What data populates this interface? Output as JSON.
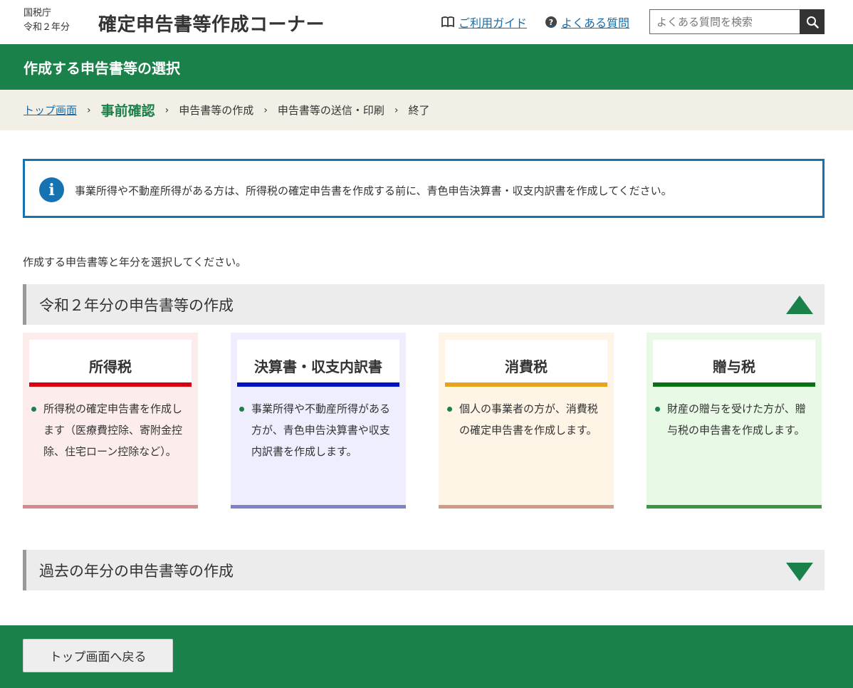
{
  "header": {
    "agency_line1": "国税庁",
    "agency_line2": "令和２年分",
    "title": "確定申告書等作成コーナー",
    "guide_link": "ご利用ガイド",
    "faq_link": "よくある質問",
    "search_placeholder": "よくある質問を検索",
    "faq_icon_glyph": "?"
  },
  "band": {
    "title": "作成する申告書等の選択"
  },
  "breadcrumb": {
    "items": [
      "トップ画面",
      "事前確認",
      "申告書等の作成",
      "申告書等の送信・印刷",
      "終了"
    ],
    "separator": "›"
  },
  "info": {
    "icon_glyph": "i",
    "message": "事業所得や不動産所得がある方は、所得税の確定申告書を作成する前に、青色申告決算書・収支内訳書を作成してください。"
  },
  "lead_text": "作成する申告書等と年分を選択してください。",
  "current_year_section": {
    "title": "令和２年分の申告書等の作成",
    "expanded": true,
    "cards": [
      {
        "title": "所得税",
        "description": "所得税の確定申告書を作成します（医療費控除、寄附金控除、住宅ローン控除など）。",
        "accent": "#d7000f",
        "background": "#fdecec"
      },
      {
        "title": "決算書・収支内訳書",
        "description": "事業所得や不動産所得がある方が、青色申告決算書や収支内訳書を作成します。",
        "accent": "#0013c6",
        "background": "#eeeeff"
      },
      {
        "title": "消費税",
        "description": "個人の事業者の方が、消費税の確定申告書を作成します。",
        "accent": "#e6a31c",
        "background": "#fef5e6"
      },
      {
        "title": "贈与税",
        "description": "財産の贈与を受けた方が、贈与税の申告書を作成します。",
        "accent": "#097312",
        "background": "#e8fae6"
      }
    ]
  },
  "past_year_section": {
    "title": "過去の年分の申告書等の作成",
    "expanded": false
  },
  "footer": {
    "back_button": "トップ画面へ戻る"
  },
  "colors": {
    "brand_green": "#1b814a",
    "link_blue": "#1a6ba8",
    "info_blue": "#1673b2",
    "breadcrumb_bg": "#f1efe6"
  },
  "icons": [
    "book-icon",
    "question-icon",
    "search-icon",
    "info-icon",
    "triangle-up-icon",
    "triangle-down-icon",
    "bullet-dot-icon"
  ]
}
